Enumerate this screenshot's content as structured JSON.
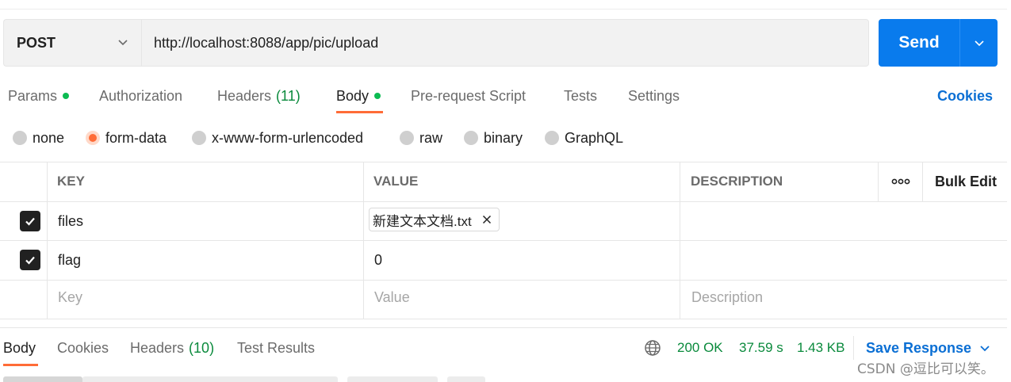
{
  "request": {
    "method": "POST",
    "url": "http://localhost:8088/app/pic/upload",
    "send_label": "Send"
  },
  "request_tabs": {
    "params": "Params",
    "authorization": "Authorization",
    "headers": "Headers",
    "headers_count": "(11)",
    "body": "Body",
    "prerequest": "Pre-request Script",
    "tests": "Tests",
    "settings": "Settings",
    "cookies": "Cookies"
  },
  "body_types": {
    "none": "none",
    "form_data": "form-data",
    "urlencoded": "x-www-form-urlencoded",
    "raw": "raw",
    "binary": "binary",
    "graphql": "GraphQL",
    "selected": "form-data"
  },
  "table": {
    "headers": {
      "key": "KEY",
      "value": "VALUE",
      "description": "DESCRIPTION",
      "bulk_edit": "Bulk Edit"
    },
    "rows": [
      {
        "key": "files",
        "value": "新建文本文档.txt",
        "checked": true
      },
      {
        "key": "flag",
        "value": "0",
        "checked": true
      }
    ],
    "placeholders": {
      "key": "Key",
      "value": "Value",
      "description": "Description"
    }
  },
  "response": {
    "tabs": {
      "body": "Body",
      "cookies": "Cookies",
      "headers": "Headers",
      "headers_count": "(10)",
      "test_results": "Test Results"
    },
    "status": "200 OK",
    "time": "37.59 s",
    "size": "1.43 KB",
    "save_response": "Save Response"
  },
  "watermark": "CSDN @逗比可以笑。",
  "colors": {
    "accent": "#ff6c37",
    "primary": "#097bed",
    "link": "#0b6fd4",
    "success": "#0a8a3c"
  }
}
